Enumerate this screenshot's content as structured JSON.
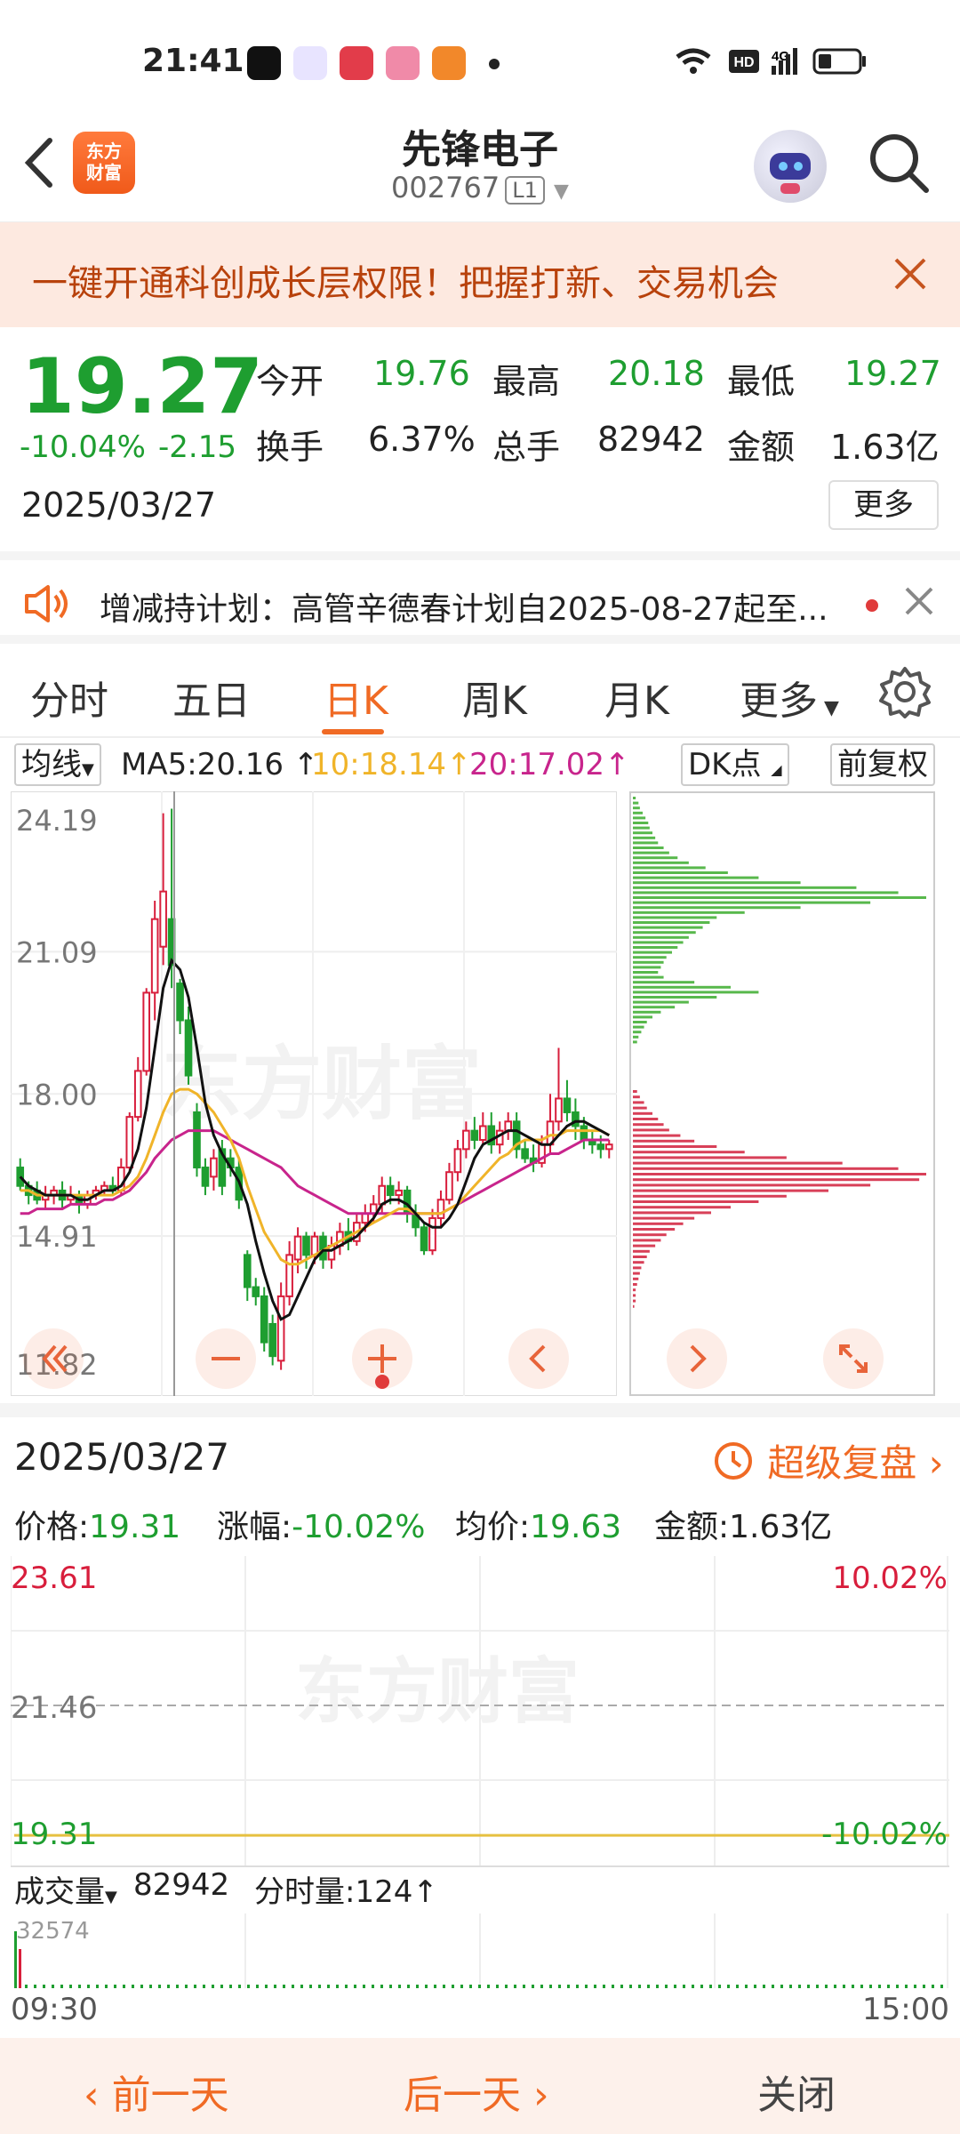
{
  "status_bar": {
    "time": "21:41",
    "icons": [
      "wifi-icon",
      "hd-icon",
      "4g-signal-icon",
      "battery-icon"
    ]
  },
  "header": {
    "brand_line1": "东方",
    "brand_line2": "财富",
    "name": "先锋电子",
    "code": "002767",
    "level": "L1"
  },
  "banner": {
    "text": "一键开通科创成长层权限！把握打新、交易机会"
  },
  "quote": {
    "price": "19.27",
    "change_pct": "-10.04%",
    "change": "-2.15",
    "date": "2025/03/27",
    "open_label": "今开",
    "open": "19.76",
    "high_label": "最高",
    "high": "20.18",
    "low_label": "最低",
    "low": "19.27",
    "turnover_label": "换手",
    "turnover": "6.37%",
    "volume_label": "总手",
    "volume": "82942",
    "amount_label": "金额",
    "amount": "1.63亿",
    "more": "更多"
  },
  "notice": {
    "text": "增减持计划：高管辛德春计划自2025-08-27起至..."
  },
  "tabs": [
    "分时",
    "五日",
    "日K",
    "周K",
    "月K",
    "更多"
  ],
  "active_tab": 2,
  "indicators": {
    "selector": "均线",
    "ma5": "MA5:20.16",
    "ma10": "10:18.14",
    "ma20": "20:17.02",
    "dk": "DK点",
    "adjust": "前复权",
    "colors": {
      "ma5": "#111111",
      "ma10": "#f0b429",
      "ma20": "#c8248c",
      "up": "#d81e3c",
      "down": "#1e9e30"
    }
  },
  "chart_data": [
    {
      "type": "candlestick",
      "title": "",
      "y_ticks": [
        "24.19",
        "21.09",
        "18.00",
        "14.91",
        "11.82"
      ],
      "ylim": [
        11.82,
        24.19
      ],
      "candles": [
        [
          16.4,
          16.0,
          16.6,
          15.9
        ],
        [
          16.0,
          15.8,
          16.1,
          15.6
        ],
        [
          15.9,
          15.7,
          16.1,
          15.6
        ],
        [
          15.7,
          15.8,
          16.0,
          15.5
        ],
        [
          15.8,
          15.9,
          16.0,
          15.6
        ],
        [
          15.9,
          15.7,
          16.1,
          15.5
        ],
        [
          15.7,
          15.8,
          16.0,
          15.6
        ],
        [
          15.8,
          15.6,
          15.9,
          15.4
        ],
        [
          15.6,
          15.8,
          15.9,
          15.5
        ],
        [
          15.8,
          15.9,
          16.0,
          15.7
        ],
        [
          15.9,
          16.0,
          16.1,
          15.8
        ],
        [
          16.0,
          15.9,
          16.2,
          15.8
        ],
        [
          15.9,
          16.4,
          16.6,
          15.8
        ],
        [
          16.4,
          17.5,
          17.6,
          16.3
        ],
        [
          17.5,
          18.5,
          18.8,
          17.4
        ],
        [
          18.5,
          20.2,
          20.3,
          18.4
        ],
        [
          20.2,
          21.8,
          22.2,
          19.6
        ],
        [
          21.2,
          22.4,
          24.1,
          20.8
        ],
        [
          21.8,
          20.8,
          24.2,
          20.3
        ],
        [
          20.4,
          19.6,
          20.5,
          19.3
        ],
        [
          19.6,
          18.4,
          19.9,
          18.2
        ],
        [
          17.6,
          16.4,
          17.8,
          16.2
        ],
        [
          16.4,
          16.0,
          16.6,
          15.8
        ],
        [
          16.2,
          16.6,
          16.8,
          15.9
        ],
        [
          16.8,
          16.0,
          17.0,
          15.8
        ],
        [
          16.6,
          16.4,
          16.8,
          16.2
        ],
        [
          16.4,
          15.7,
          16.6,
          15.5
        ],
        [
          14.5,
          13.8,
          14.6,
          13.5
        ],
        [
          13.8,
          13.6,
          14.0,
          13.4
        ],
        [
          13.6,
          12.6,
          13.8,
          12.4
        ],
        [
          13.0,
          12.3,
          13.2,
          12.1
        ],
        [
          12.2,
          13.6,
          13.9,
          12.0
        ],
        [
          13.6,
          14.5,
          14.8,
          13.4
        ],
        [
          14.4,
          14.9,
          15.1,
          14.1
        ],
        [
          14.9,
          14.5,
          15.0,
          14.2
        ],
        [
          14.5,
          14.9,
          15.0,
          14.3
        ],
        [
          14.9,
          14.4,
          15.0,
          14.2
        ],
        [
          14.4,
          14.7,
          14.9,
          14.2
        ],
        [
          14.7,
          15.0,
          15.2,
          14.5
        ],
        [
          15.0,
          14.8,
          15.3,
          14.6
        ],
        [
          14.8,
          15.2,
          15.4,
          14.7
        ],
        [
          15.2,
          15.4,
          15.6,
          15.0
        ],
        [
          15.4,
          15.6,
          15.8,
          15.2
        ],
        [
          15.6,
          16.0,
          16.2,
          15.4
        ],
        [
          16.0,
          15.8,
          16.2,
          15.6
        ],
        [
          15.8,
          15.9,
          16.1,
          15.6
        ],
        [
          15.9,
          15.4,
          16.0,
          15.2
        ],
        [
          15.4,
          15.1,
          15.6,
          14.9
        ],
        [
          15.1,
          14.6,
          15.2,
          14.5
        ],
        [
          14.6,
          15.3,
          15.5,
          14.5
        ],
        [
          15.3,
          15.7,
          15.9,
          15.1
        ],
        [
          15.7,
          16.3,
          16.5,
          15.6
        ],
        [
          16.3,
          16.8,
          17.0,
          16.1
        ],
        [
          16.8,
          17.2,
          17.4,
          16.6
        ],
        [
          17.2,
          17.0,
          17.5,
          16.8
        ],
        [
          17.0,
          17.3,
          17.6,
          16.9
        ],
        [
          17.3,
          16.9,
          17.6,
          16.7
        ],
        [
          16.9,
          17.2,
          17.4,
          16.7
        ],
        [
          17.2,
          17.4,
          17.6,
          17.0
        ],
        [
          17.4,
          16.8,
          17.6,
          16.6
        ],
        [
          16.8,
          16.6,
          17.0,
          16.5
        ],
        [
          16.6,
          16.5,
          16.9,
          16.3
        ],
        [
          16.5,
          16.9,
          17.1,
          16.4
        ],
        [
          16.9,
          17.4,
          18.0,
          16.7
        ],
        [
          17.4,
          17.9,
          19.0,
          17.2
        ],
        [
          17.9,
          17.6,
          18.3,
          17.4
        ],
        [
          17.6,
          17.3,
          17.9,
          17.0
        ],
        [
          17.3,
          17.0,
          17.5,
          16.8
        ],
        [
          17.0,
          16.9,
          17.2,
          16.7
        ],
        [
          16.9,
          16.8,
          17.1,
          16.6
        ],
        [
          16.8,
          16.9,
          17.0,
          16.6
        ]
      ],
      "ma5": [
        16.2,
        16.0,
        15.9,
        15.8,
        15.8,
        15.8,
        15.8,
        15.7,
        15.7,
        15.8,
        15.9,
        15.9,
        16.0,
        16.3,
        16.8,
        17.7,
        19.0,
        20.3,
        20.9,
        20.7,
        20.1,
        19.0,
        17.8,
        17.1,
        16.7,
        16.4,
        16.1,
        15.6,
        14.8,
        14.1,
        13.5,
        13.1,
        13.2,
        13.6,
        14.0,
        14.4,
        14.6,
        14.6,
        14.7,
        14.8,
        14.9,
        15.1,
        15.3,
        15.6,
        15.7,
        15.7,
        15.6,
        15.4,
        15.2,
        15.1,
        15.1,
        15.3,
        15.6,
        16.1,
        16.6,
        16.9,
        17.0,
        17.1,
        17.2,
        17.2,
        17.1,
        17.0,
        16.9,
        16.9,
        17.1,
        17.3,
        17.4,
        17.4,
        17.3,
        17.2,
        17.1
      ],
      "ma10": [
        15.9,
        15.9,
        15.8,
        15.8,
        15.8,
        15.8,
        15.8,
        15.8,
        15.8,
        15.8,
        15.8,
        15.8,
        15.9,
        16.0,
        16.2,
        16.6,
        17.1,
        17.6,
        18.0,
        18.1,
        18.1,
        18.0,
        17.8,
        17.6,
        17.3,
        17.0,
        16.6,
        16.0,
        15.5,
        15.0,
        14.7,
        14.4,
        14.3,
        14.3,
        14.4,
        14.5,
        14.6,
        14.7,
        14.8,
        14.9,
        15.0,
        15.1,
        15.2,
        15.3,
        15.4,
        15.5,
        15.5,
        15.4,
        15.4,
        15.4,
        15.4,
        15.5,
        15.6,
        15.8,
        16.0,
        16.2,
        16.4,
        16.6,
        16.7,
        16.9,
        17.0,
        17.0,
        17.0,
        17.1,
        17.1,
        17.2,
        17.2,
        17.2,
        17.2,
        17.2,
        17.1
      ],
      "ma20": [
        15.4,
        15.4,
        15.5,
        15.5,
        15.5,
        15.5,
        15.6,
        15.6,
        15.6,
        15.6,
        15.7,
        15.7,
        15.8,
        15.9,
        16.1,
        16.3,
        16.6,
        16.8,
        17.0,
        17.1,
        17.2,
        17.2,
        17.2,
        17.2,
        17.1,
        17.0,
        16.9,
        16.8,
        16.7,
        16.6,
        16.5,
        16.4,
        16.2,
        16.0,
        15.9,
        15.8,
        15.7,
        15.6,
        15.5,
        15.4,
        15.4,
        15.4,
        15.4,
        15.4,
        15.4,
        15.4,
        15.4,
        15.4,
        15.4,
        15.4,
        15.4,
        15.5,
        15.6,
        15.7,
        15.8,
        15.9,
        16.0,
        16.1,
        16.2,
        16.3,
        16.4,
        16.5,
        16.6,
        16.7,
        16.7,
        16.8,
        16.9,
        17.0,
        17.0,
        17.0,
        17.0
      ]
    },
    {
      "type": "bar",
      "title": "",
      "upper_counts": [
        2,
        4,
        5,
        7,
        9,
        11,
        12,
        14,
        16,
        18,
        22,
        26,
        32,
        40,
        52,
        68,
        90,
        120,
        160,
        190,
        210,
        170,
        120,
        80,
        60,
        55,
        50,
        45,
        40,
        36,
        32,
        28,
        24,
        22,
        20,
        18,
        22,
        44,
        70,
        90,
        60,
        40,
        30,
        20,
        14,
        10,
        8,
        6,
        4,
        3
      ],
      "lower_counts": [
        3,
        5,
        8,
        10,
        14,
        18,
        22,
        26,
        34,
        44,
        60,
        80,
        110,
        150,
        190,
        210,
        205,
        170,
        140,
        110,
        90,
        70,
        56,
        44,
        36,
        30,
        24,
        20,
        16,
        12,
        10,
        8,
        6,
        5,
        4,
        3,
        2,
        2,
        2,
        1
      ],
      "upper_color": "#58b84c",
      "lower_color": "#d84058"
    },
    {
      "type": "line",
      "title": "",
      "y_left": [
        "23.61",
        "21.46",
        "19.31"
      ],
      "y_right": [
        "10.02%",
        "-10.02%"
      ],
      "x_ticks": [
        "09:30",
        "15:00"
      ],
      "price_line_value": 19.31,
      "avg_line_value": 19.63
    }
  ],
  "day_detail": {
    "date": "2025/03/27",
    "replay": "超级复盘",
    "price_label": "价格:",
    "price": "19.31",
    "chg_label": "涨幅:",
    "chg": "-10.02%",
    "avg_label": "均价:",
    "avg": "19.63",
    "amount_label": "金额:",
    "amount": "1.63亿"
  },
  "volume": {
    "selector": "成交量",
    "total": "82942",
    "tick_label": "分时量:124",
    "axis_max": "32574"
  },
  "bottom": {
    "prev": "前一天",
    "next": "后一天",
    "close": "关闭"
  },
  "watermark": "东方财富"
}
